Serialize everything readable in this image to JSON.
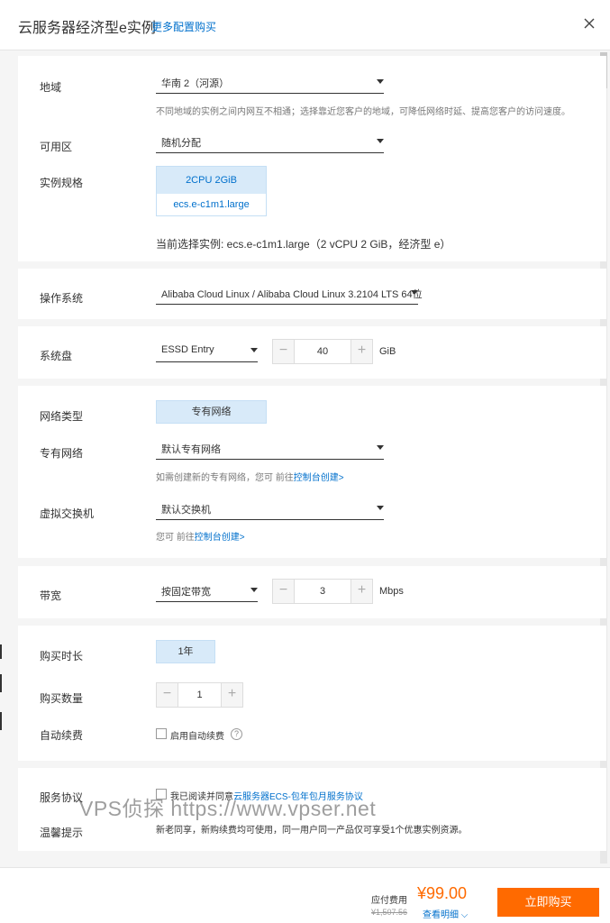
{
  "header": {
    "title": "云服务器经济型e实例",
    "config_link": "更多配置购买"
  },
  "region": {
    "label": "地域",
    "value": "华南 2（河源）",
    "hint": "不同地域的实例之间内网互不相通；选择靠近您客户的地域，可降低网络时延、提高您客户的访问速度。"
  },
  "zone": {
    "label": "可用区",
    "value": "随机分配"
  },
  "spec": {
    "label": "实例规格",
    "box_top": "2CPU 2GiB",
    "box_bottom": "ecs.e-c1m1.large",
    "current": "当前选择实例: ecs.e-c1m1.large（2 vCPU 2 GiB，经济型 e）"
  },
  "os": {
    "label": "操作系统",
    "value": "Alibaba Cloud Linux / Alibaba Cloud Linux 3.2104 LTS 64位"
  },
  "disk": {
    "label": "系统盘",
    "type": "ESSD Entry",
    "size": "40",
    "unit": "GiB",
    "minus": "−",
    "plus": "+"
  },
  "network": {
    "type_label": "网络类型",
    "type_value": "专有网络",
    "vpc_label": "专有网络",
    "vpc_value": "默认专有网络",
    "vpc_hint_prefix": "如需创建新的专有网络，您可 前往",
    "vpc_hint_link": "控制台创建>",
    "vswitch_label": "虚拟交换机",
    "vswitch_value": "默认交换机",
    "vswitch_hint_prefix": "您可 前往",
    "vswitch_hint_link": "控制台创建>"
  },
  "bandwidth": {
    "label": "带宽",
    "type": "按固定带宽",
    "value": "3",
    "unit": "Mbps",
    "minus": "−",
    "plus": "+"
  },
  "purchase": {
    "duration_label": "购买时长",
    "duration_value": "1年",
    "quantity_label": "购买数量",
    "quantity_value": "1",
    "minus": "−",
    "plus": "+",
    "renew_label": "自动续费",
    "renew_checkbox": "启用自动续费",
    "help": "?"
  },
  "agreement": {
    "label": "服务协议",
    "text_prefix": "我已阅读并同意",
    "link": "云服务器ECS-包年包月服务协议",
    "notice_label": "温馨提示",
    "notice_text": "新老同享，新购续费均可使用，同一用户同一产品仅可享受1个优惠实例资源。"
  },
  "watermark": "VPS侦探 https://www.vpser.net",
  "footer": {
    "fee_label": "应付费用",
    "price": "¥99.00",
    "original": "¥1,507.56",
    "detail": "查看明细 ⌵",
    "buy": "立即购买"
  },
  "colors": {
    "accent": "#0070cc",
    "price": "#ff6a00",
    "selected_bg": "#d8eaf9"
  }
}
